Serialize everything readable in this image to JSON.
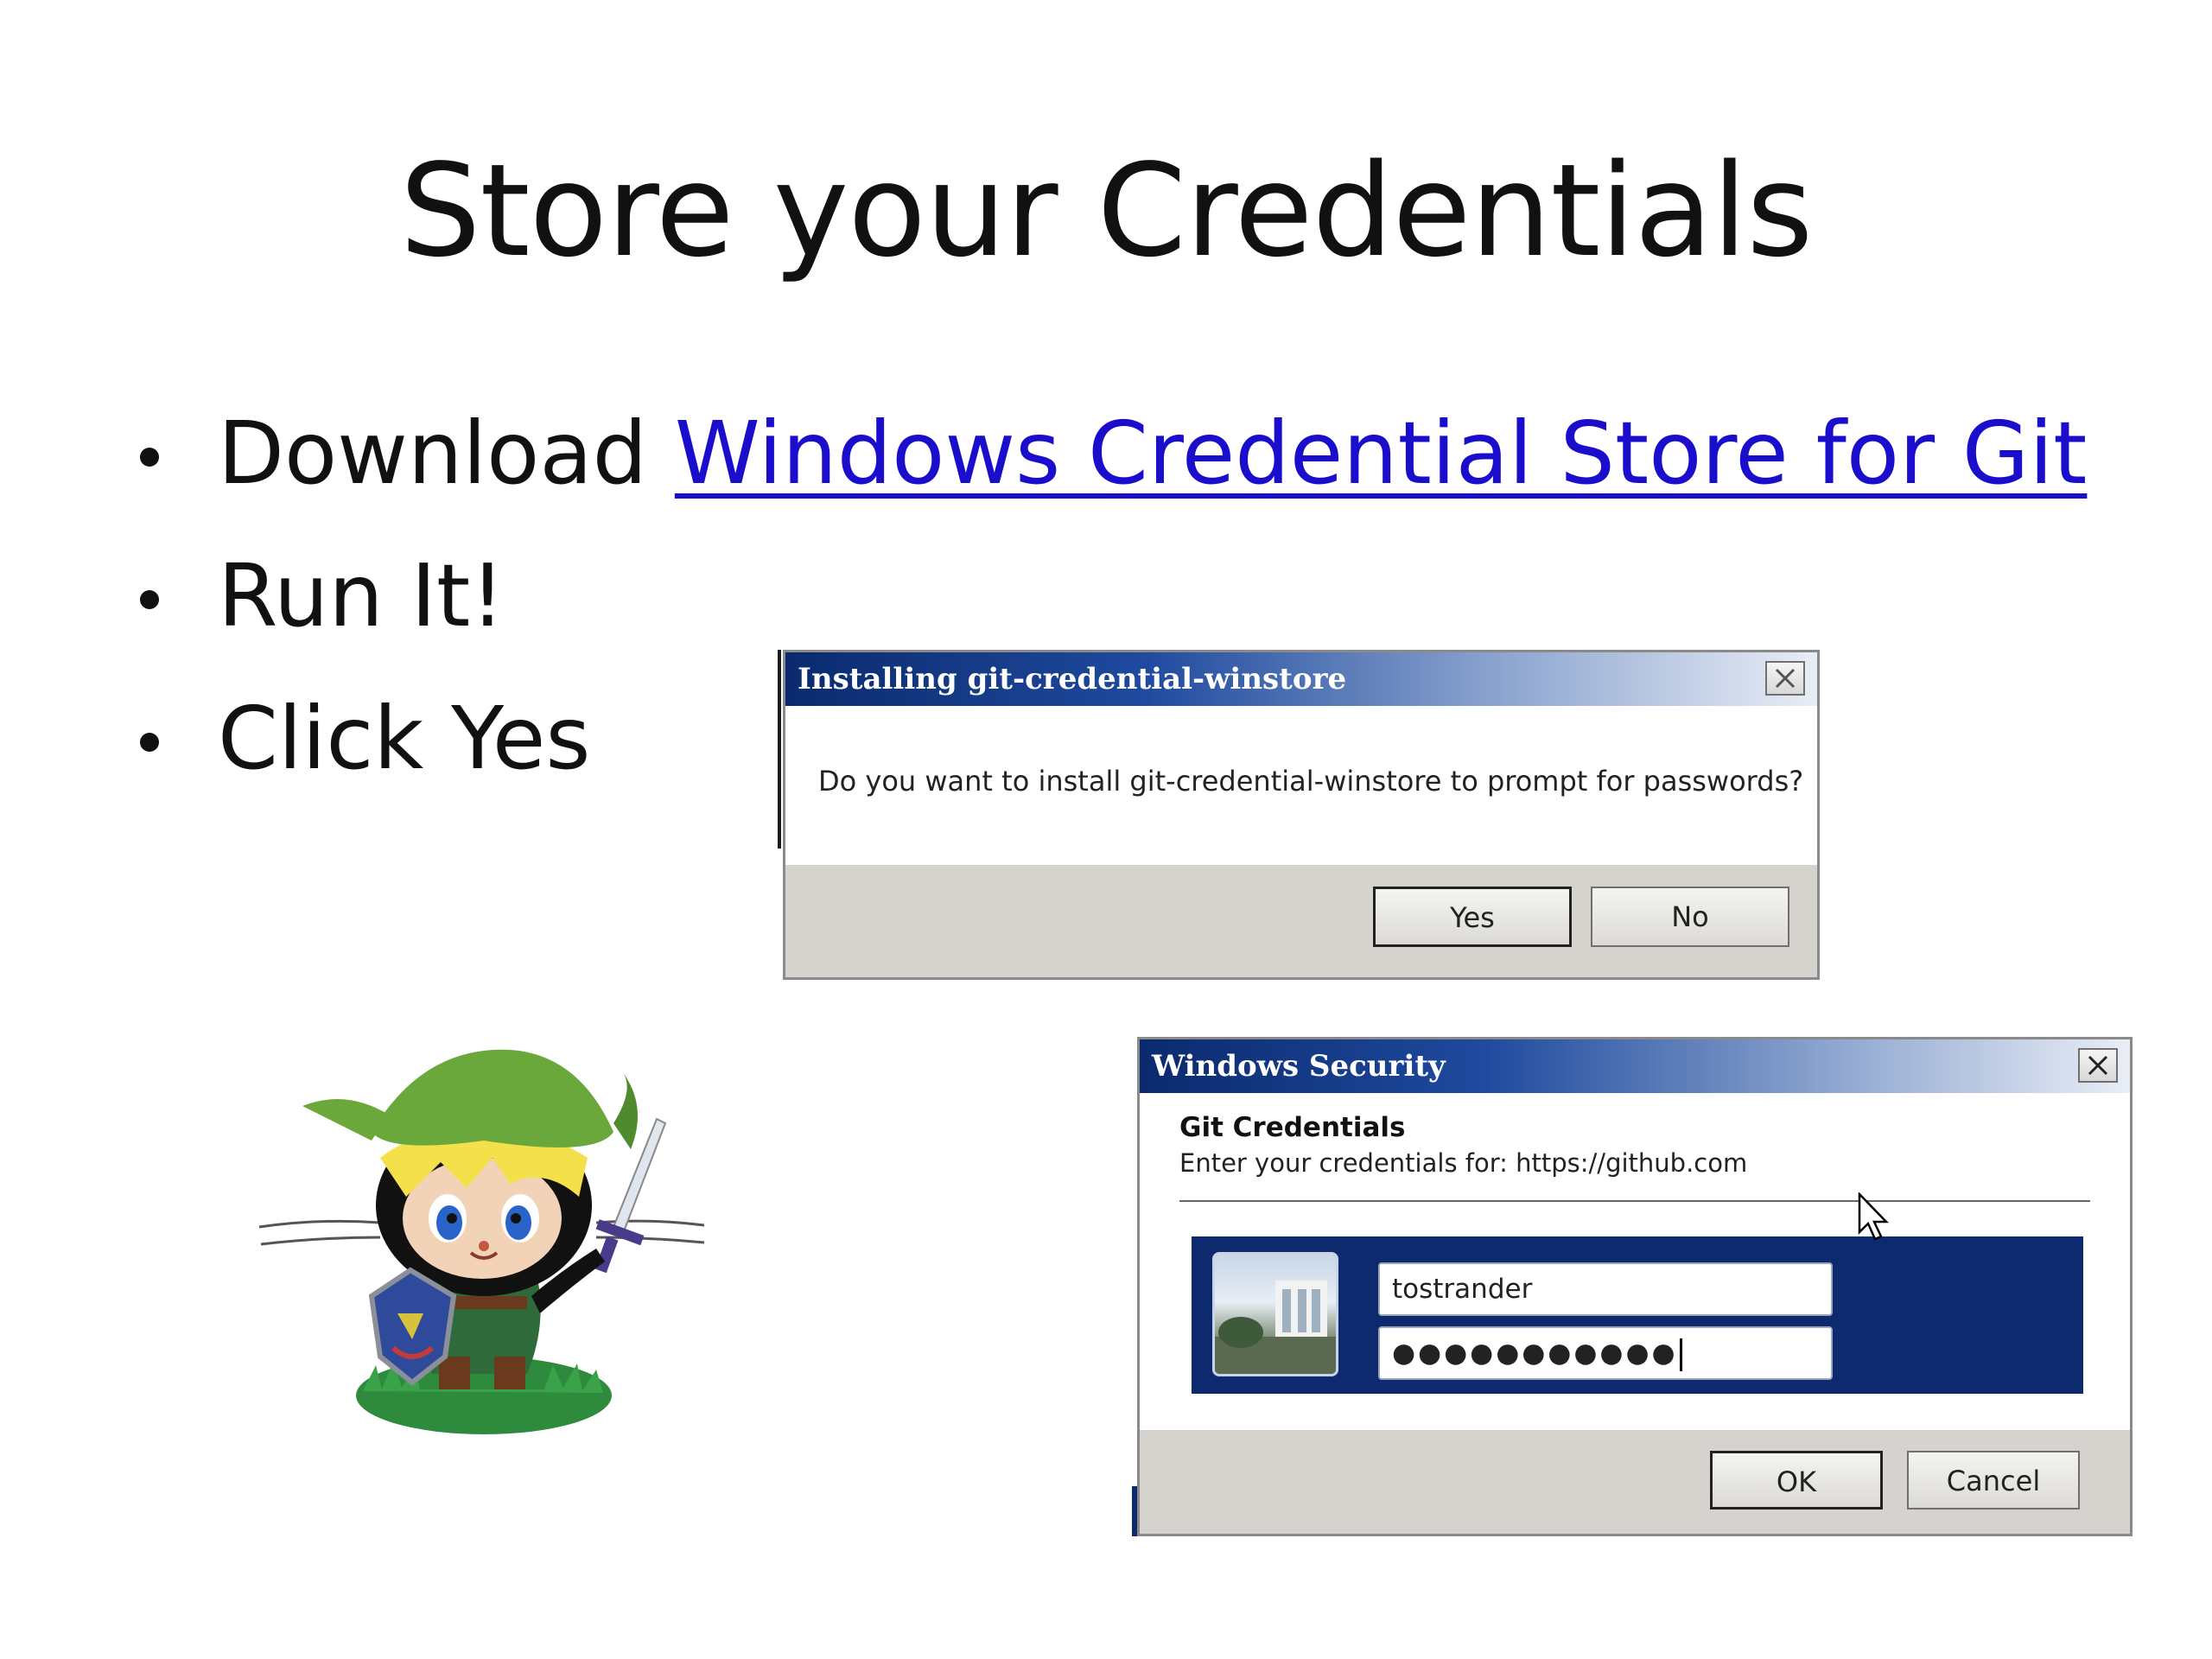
{
  "slide": {
    "title": "Store your Credentials",
    "bullets": [
      {
        "prefix": "Download ",
        "link_text": "Windows Credential Store for Git"
      },
      {
        "text": "Run It!"
      },
      {
        "text": "Click Yes"
      }
    ]
  },
  "install_dialog": {
    "title": "Installing git-credential-winstore",
    "message": "Do you want to install git-credential-winstore to prompt for passwords?",
    "yes_label": "Yes",
    "no_label": "No"
  },
  "security_dialog": {
    "title": "Windows Security",
    "heading": "Git Credentials",
    "subheading": "Enter your credentials for: https://github.com",
    "username_value": "tostrander",
    "password_value": "●●●●●●●●●●●",
    "ok_label": "OK",
    "cancel_label": "Cancel"
  },
  "colors": {
    "link": "#1a0dcc",
    "titlebar_start": "#0b2a6e",
    "credential_panel": "#0e2a6e",
    "dialog_footer": "#d6d3ce"
  },
  "icons": [
    "close-icon",
    "user-tile-icon",
    "mouse-cursor-icon",
    "octocat-link-mascot"
  ]
}
